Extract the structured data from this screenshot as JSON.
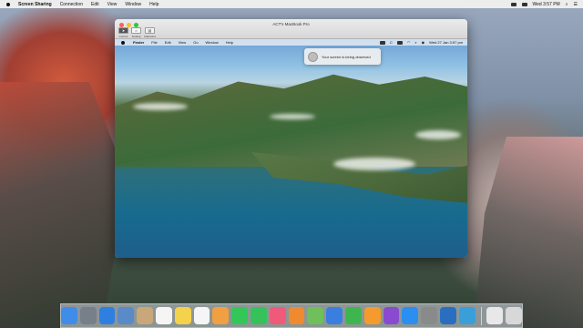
{
  "host_menubar": {
    "app_name": "Screen Sharing",
    "items": [
      "Connection",
      "Edit",
      "View",
      "Window",
      "Help"
    ],
    "clock": "Wed 3:57 PM"
  },
  "window": {
    "title": "ACT's MacBook Pro",
    "toolbar": [
      {
        "label": "Control",
        "icon": "cursor-icon"
      },
      {
        "label": "Scaling",
        "icon": "home-icon"
      },
      {
        "label": "Clipboard",
        "icon": "clipboard-icon"
      }
    ]
  },
  "remote_menubar": {
    "app_name": "Finder",
    "items": [
      "File",
      "Edit",
      "View",
      "Go",
      "Window",
      "Help"
    ],
    "clock": "Wed 27 Jan  3:57 pm"
  },
  "notification": {
    "text": "Your screen is being observed"
  },
  "remote_dock": {
    "apps": [
      {
        "name": "finder-icon",
        "color": "#3f8de8"
      },
      {
        "name": "launchpad-icon",
        "color": "#8e9aa8"
      },
      {
        "name": "safari-icon",
        "color": "#2f7fe0"
      },
      {
        "name": "messages-icon",
        "color": "#33c759"
      },
      {
        "name": "mail-icon",
        "color": "#3a8ef0"
      },
      {
        "name": "maps-icon",
        "color": "#6fbf5a"
      },
      {
        "name": "photos-icon",
        "color": "#f0a040"
      },
      {
        "name": "facetime-icon",
        "color": "#35c25a"
      },
      {
        "name": "calendar-icon",
        "color": "#f5f5f5"
      },
      {
        "name": "contacts-icon",
        "color": "#c9a77a"
      },
      {
        "name": "reminders-icon",
        "color": "#f5f5f5"
      },
      {
        "name": "notes-icon",
        "color": "#f4d24b"
      },
      {
        "name": "tv-icon",
        "color": "#222222"
      },
      {
        "name": "music-icon",
        "color": "#f0405a"
      },
      {
        "name": "podcasts-icon",
        "color": "#9b4fd9"
      },
      {
        "name": "news-icon",
        "color": "#f04050"
      },
      {
        "name": "keynote-icon",
        "color": "#f5f5f5"
      },
      {
        "name": "numbers-icon",
        "color": "#3fb550"
      },
      {
        "name": "pages-icon",
        "color": "#f59a2c"
      },
      {
        "name": "app-store-icon",
        "color": "#2c8ef0"
      },
      {
        "name": "system-preferences-icon",
        "color": "#8a8a8a"
      },
      {
        "name": "instruments-icon",
        "color": "#4a4a4a"
      },
      {
        "name": "downloads-icon",
        "color": "#e0e0e0"
      },
      {
        "name": "trash-icon",
        "color": "#d8d8d8"
      }
    ]
  },
  "host_dock": {
    "apps": [
      {
        "name": "finder-icon",
        "color": "#3f8de8"
      },
      {
        "name": "launchpad-icon",
        "color": "#777f8a"
      },
      {
        "name": "safari-icon",
        "color": "#2f7fe0"
      },
      {
        "name": "mail-icon",
        "color": "#5a8ac8"
      },
      {
        "name": "contacts-icon",
        "color": "#c9a77a"
      },
      {
        "name": "calendar-icon",
        "color": "#f5f5f5"
      },
      {
        "name": "notes-icon",
        "color": "#f4d24b"
      },
      {
        "name": "reminders-icon",
        "color": "#f5f5f5"
      },
      {
        "name": "photos-icon",
        "color": "#f0a040"
      },
      {
        "name": "messages-icon",
        "color": "#33c759"
      },
      {
        "name": "facetime-icon",
        "color": "#35c25a"
      },
      {
        "name": "itunes-icon",
        "color": "#f05a7a"
      },
      {
        "name": "ibooks-icon",
        "color": "#f08a30"
      },
      {
        "name": "maps-icon",
        "color": "#6fbf5a"
      },
      {
        "name": "keynote-icon",
        "color": "#3a7ee0"
      },
      {
        "name": "numbers-icon",
        "color": "#3fb550"
      },
      {
        "name": "pages-icon",
        "color": "#f59a2c"
      },
      {
        "name": "instruments-icon",
        "color": "#8a4ad0"
      },
      {
        "name": "app-store-icon",
        "color": "#2c8ef0"
      },
      {
        "name": "system-preferences-icon",
        "color": "#8a8a8a"
      },
      {
        "name": "screen-sharing-icon",
        "color": "#2a6fbf"
      },
      {
        "name": "quicktime-icon",
        "color": "#3a9fd9"
      }
    ],
    "trash": [
      {
        "name": "document-icon",
        "color": "#e8e8e8"
      },
      {
        "name": "trash-icon",
        "color": "#d8d8d8"
      }
    ]
  }
}
